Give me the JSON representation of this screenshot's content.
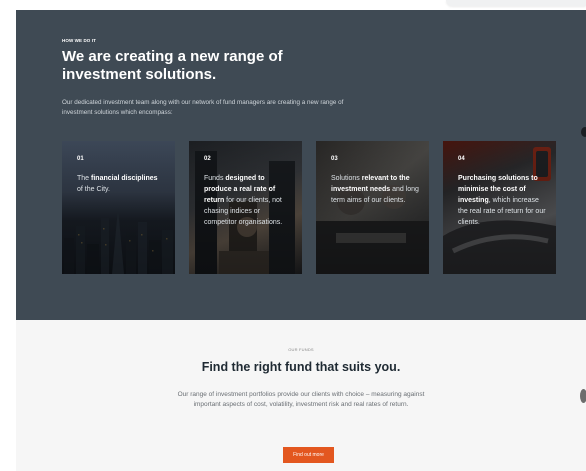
{
  "hero": {
    "eyebrow": "HOW WE DO IT",
    "title": "We are creating a new range of investment solutions.",
    "description": "Our dedicated investment team along with our network of fund managers are creating a new range of investment solutions which encompass:"
  },
  "cards": [
    {
      "number": "01",
      "parts": [
        [
          "The ",
          false
        ],
        [
          "financial disciplines",
          true
        ],
        [
          " of the City.",
          false
        ]
      ]
    },
    {
      "number": "02",
      "parts": [
        [
          "Funds ",
          false
        ],
        [
          "designed to produce a real rate of return",
          true
        ],
        [
          " for our clients, not chasing indices or competitor organisations.",
          false
        ]
      ]
    },
    {
      "number": "03",
      "parts": [
        [
          "Solutions ",
          false
        ],
        [
          "relevant to the investment needs",
          true
        ],
        [
          " and long term aims of our clients.",
          false
        ]
      ]
    },
    {
      "number": "04",
      "parts": [
        [
          "Purchasing solutions to minimise the cost of investing",
          true
        ],
        [
          ", which increase the real rate of return for our clients.",
          false
        ]
      ]
    }
  ],
  "funds": {
    "eyebrow": "OUR FUNDS",
    "title": "Find the right fund that suits you.",
    "description": "Our range of investment portfolios provide our clients with choice – measuring against important aspects of cost, volatility, investment risk and real rates of return.",
    "button_label": "Find out more"
  },
  "colors": {
    "hero_bg": "#3f4a54",
    "accent": "#e3571f",
    "fund_bg": "#f6f6f6"
  }
}
